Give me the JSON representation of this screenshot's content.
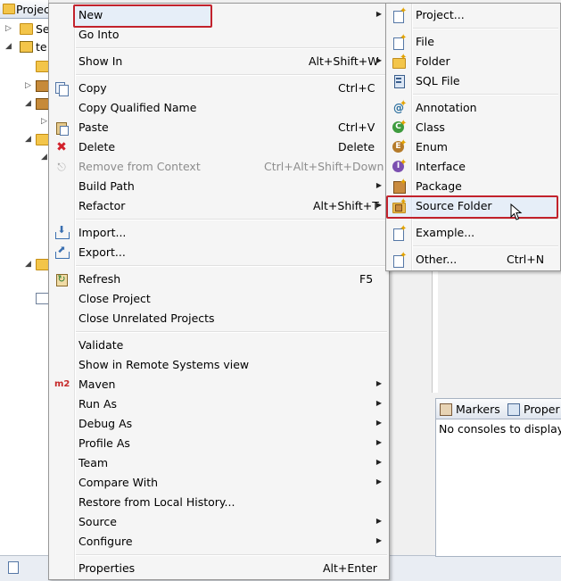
{
  "background": {
    "project_tab": "Projec",
    "tree": [
      {
        "label": "Se",
        "arrow": "▷"
      },
      {
        "label": "te",
        "arrow": "◢"
      }
    ],
    "right_tabs": [
      "Markers",
      "Proper"
    ],
    "no_consoles": "No consoles to display"
  },
  "context_menu": {
    "items": [
      {
        "key": "new",
        "label": "New",
        "accel": "",
        "submenu": true
      },
      {
        "key": "go-into",
        "label": "Go Into",
        "accel": ""
      },
      {
        "key": "show-in",
        "label": "Show In",
        "accel": "Alt+Shift+W",
        "submenu": true
      },
      {
        "key": "copy",
        "label": "Copy",
        "accel": "Ctrl+C"
      },
      {
        "key": "copy-qualified-name",
        "label": "Copy Qualified Name",
        "accel": ""
      },
      {
        "key": "paste",
        "label": "Paste",
        "accel": "Ctrl+V"
      },
      {
        "key": "delete",
        "label": "Delete",
        "accel": "Delete"
      },
      {
        "key": "remove-from-context",
        "label": "Remove from Context",
        "accel": "Ctrl+Alt+Shift+Down",
        "disabled": true
      },
      {
        "key": "build-path",
        "label": "Build Path",
        "accel": "",
        "submenu": true
      },
      {
        "key": "refactor",
        "label": "Refactor",
        "accel": "Alt+Shift+T",
        "submenu": true
      },
      {
        "key": "import",
        "label": "Import...",
        "accel": ""
      },
      {
        "key": "export",
        "label": "Export...",
        "accel": ""
      },
      {
        "key": "refresh",
        "label": "Refresh",
        "accel": "F5"
      },
      {
        "key": "close-project",
        "label": "Close Project",
        "accel": ""
      },
      {
        "key": "close-unrelated-projects",
        "label": "Close Unrelated Projects",
        "accel": ""
      },
      {
        "key": "validate",
        "label": "Validate",
        "accel": ""
      },
      {
        "key": "show-in-remote-systems",
        "label": "Show in Remote Systems view",
        "accel": ""
      },
      {
        "key": "maven",
        "label": "Maven",
        "accel": "",
        "submenu": true
      },
      {
        "key": "run-as",
        "label": "Run As",
        "accel": "",
        "submenu": true
      },
      {
        "key": "debug-as",
        "label": "Debug As",
        "accel": "",
        "submenu": true
      },
      {
        "key": "profile-as",
        "label": "Profile As",
        "accel": "",
        "submenu": true
      },
      {
        "key": "team",
        "label": "Team",
        "accel": "",
        "submenu": true
      },
      {
        "key": "compare-with",
        "label": "Compare With",
        "accel": "",
        "submenu": true
      },
      {
        "key": "restore-from-local-history",
        "label": "Restore from Local History...",
        "accel": ""
      },
      {
        "key": "source",
        "label": "Source",
        "accel": "",
        "submenu": true
      },
      {
        "key": "configure",
        "label": "Configure",
        "accel": "",
        "submenu": true
      },
      {
        "key": "properties",
        "label": "Properties",
        "accel": "Alt+Enter"
      }
    ],
    "maven_icon_text": "m2"
  },
  "new_submenu": {
    "items": [
      {
        "key": "project",
        "label": "Project...",
        "accel": ""
      },
      {
        "key": "file",
        "label": "File",
        "accel": ""
      },
      {
        "key": "folder",
        "label": "Folder",
        "accel": ""
      },
      {
        "key": "sql-file",
        "label": "SQL File",
        "accel": ""
      },
      {
        "key": "annotation",
        "label": "Annotation",
        "accel": ""
      },
      {
        "key": "class",
        "label": "Class",
        "accel": ""
      },
      {
        "key": "enum",
        "label": "Enum",
        "accel": ""
      },
      {
        "key": "interface",
        "label": "Interface",
        "accel": ""
      },
      {
        "key": "package",
        "label": "Package",
        "accel": ""
      },
      {
        "key": "source-folder",
        "label": "Source Folder",
        "accel": ""
      },
      {
        "key": "example",
        "label": "Example...",
        "accel": ""
      },
      {
        "key": "other",
        "label": "Other...",
        "accel": "Ctrl+N"
      }
    ]
  },
  "colors": {
    "highlight_border": "#c2222c",
    "menu_bg": "#f5f5f5"
  }
}
